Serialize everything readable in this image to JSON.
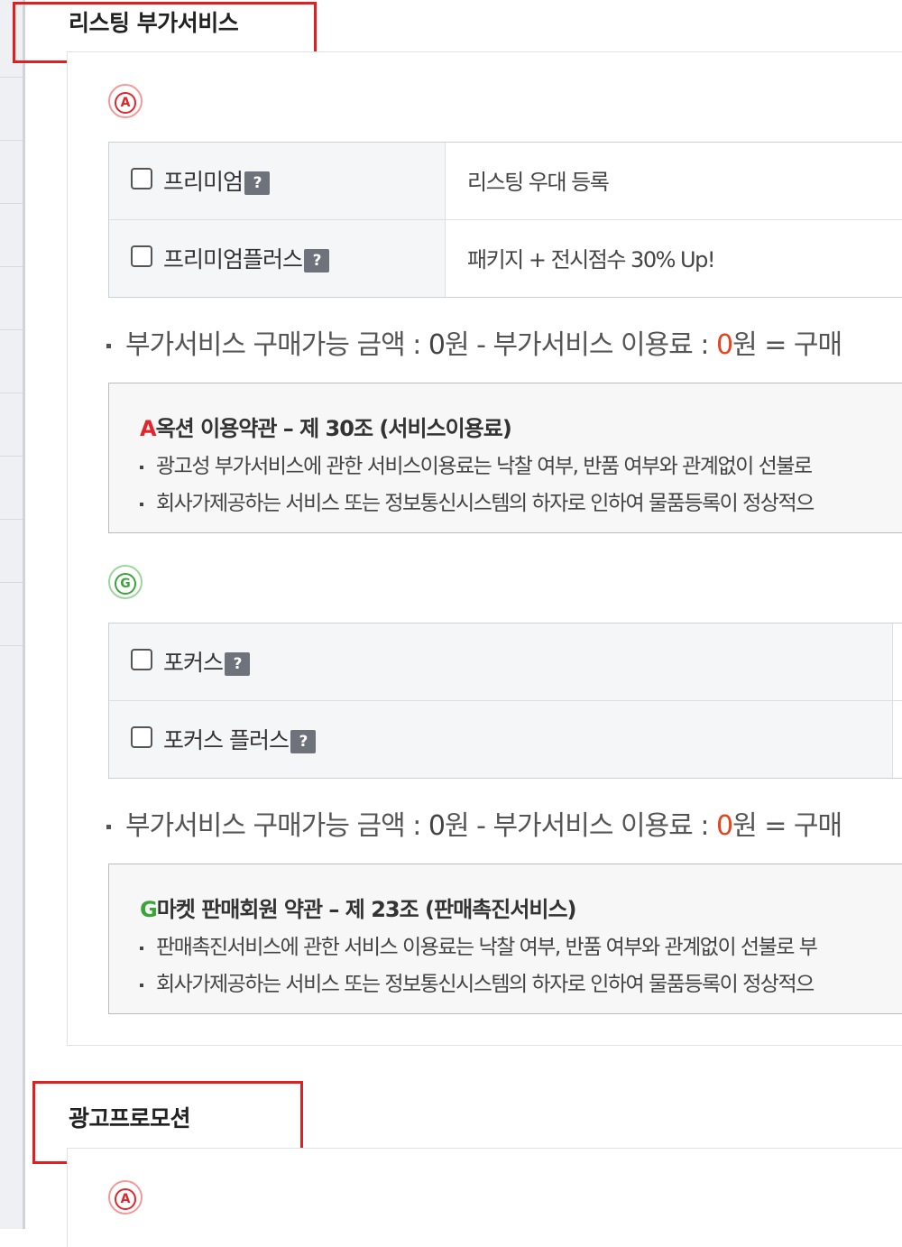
{
  "sections": {
    "listing": {
      "title": "리스팅 부가서비스",
      "auction_badge": "A",
      "auction_services": [
        {
          "name": "프리미엄",
          "help": "?",
          "desc": "리스팅 우대 등록"
        },
        {
          "name": "프리미엄플러스",
          "help": "?",
          "desc": "패키지 + 전시점수 30% Up!"
        }
      ],
      "auction_budget": {
        "prefix": "부가서비스 구매가능 금액 : ",
        "available": "0",
        "unit1": "원 - 부가서비스 이용료 : ",
        "fee": "0",
        "unit2": "원 = 구매"
      },
      "auction_terms": {
        "lead": "A",
        "title": "옥션 이용약관 – 제 30조 (서비스이용료)",
        "line1": "광고성 부가서비스에 관한 서비스이용료는 낙찰 여부, 반품 여부와 관계없이 선불로",
        "line2": "회사가제공하는 서비스 또는 정보통신시스템의 하자로 인하여 물품등록이 정상적으"
      },
      "gmarket_badge": "G",
      "gmarket_services": [
        {
          "name": "포커스",
          "help": "?"
        },
        {
          "name": "포커스 플러스",
          "help": "?"
        }
      ],
      "gmarket_budget": {
        "prefix": "부가서비스 구매가능 금액 : ",
        "available": "0",
        "unit1": "원 - 부가서비스 이용료 : ",
        "fee": "0",
        "unit2": "원 = 구매"
      },
      "gmarket_terms": {
        "lead": "G",
        "title": "마켓 판매회원 약관 – 제 23조 (판매촉진서비스)",
        "line1": "판매촉진서비스에 관한 서비스 이용료는 낙찰 여부, 반품 여부와 관계없이 선불로 부",
        "line2": "회사가제공하는 서비스 또는 정보통신시스템의 하자로 인하여 물품등록이 정상적으"
      }
    },
    "ad_promotion": {
      "title": "광고프로모션",
      "auction_badge": "A"
    }
  },
  "colors": {
    "highlight_box": "#e02020",
    "auction_red": "#e0262b",
    "gmarket_green": "#3aa43a",
    "fee_orange": "#e8431c"
  }
}
